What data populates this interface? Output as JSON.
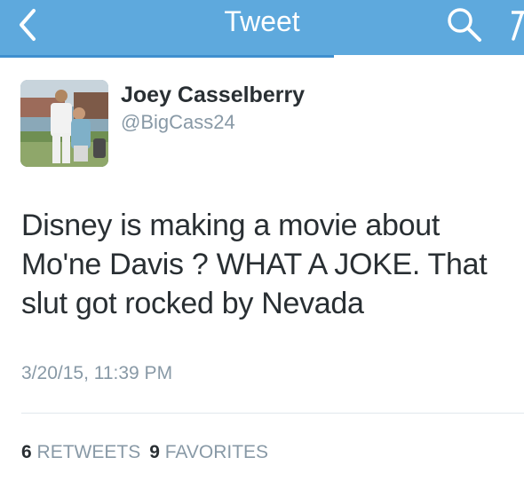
{
  "nav": {
    "title": "Tweet",
    "back_icon": "chevron-left-icon",
    "search_icon": "search-icon",
    "compose_icon": "compose-icon",
    "bar_color": "#5ea9dd"
  },
  "tweet": {
    "author_name": "Joey Casselberry",
    "author_handle": "@BigCass24",
    "text": "Disney is making a movie about Mo'ne Davis ? WHAT A JOKE. That slut got rocked by Nevada",
    "timestamp": "3/20/15, 11:39 PM",
    "retweets_count": "6",
    "retweets_label": "RETWEETS",
    "favorites_count": "9",
    "favorites_label": "FAVORITES"
  }
}
